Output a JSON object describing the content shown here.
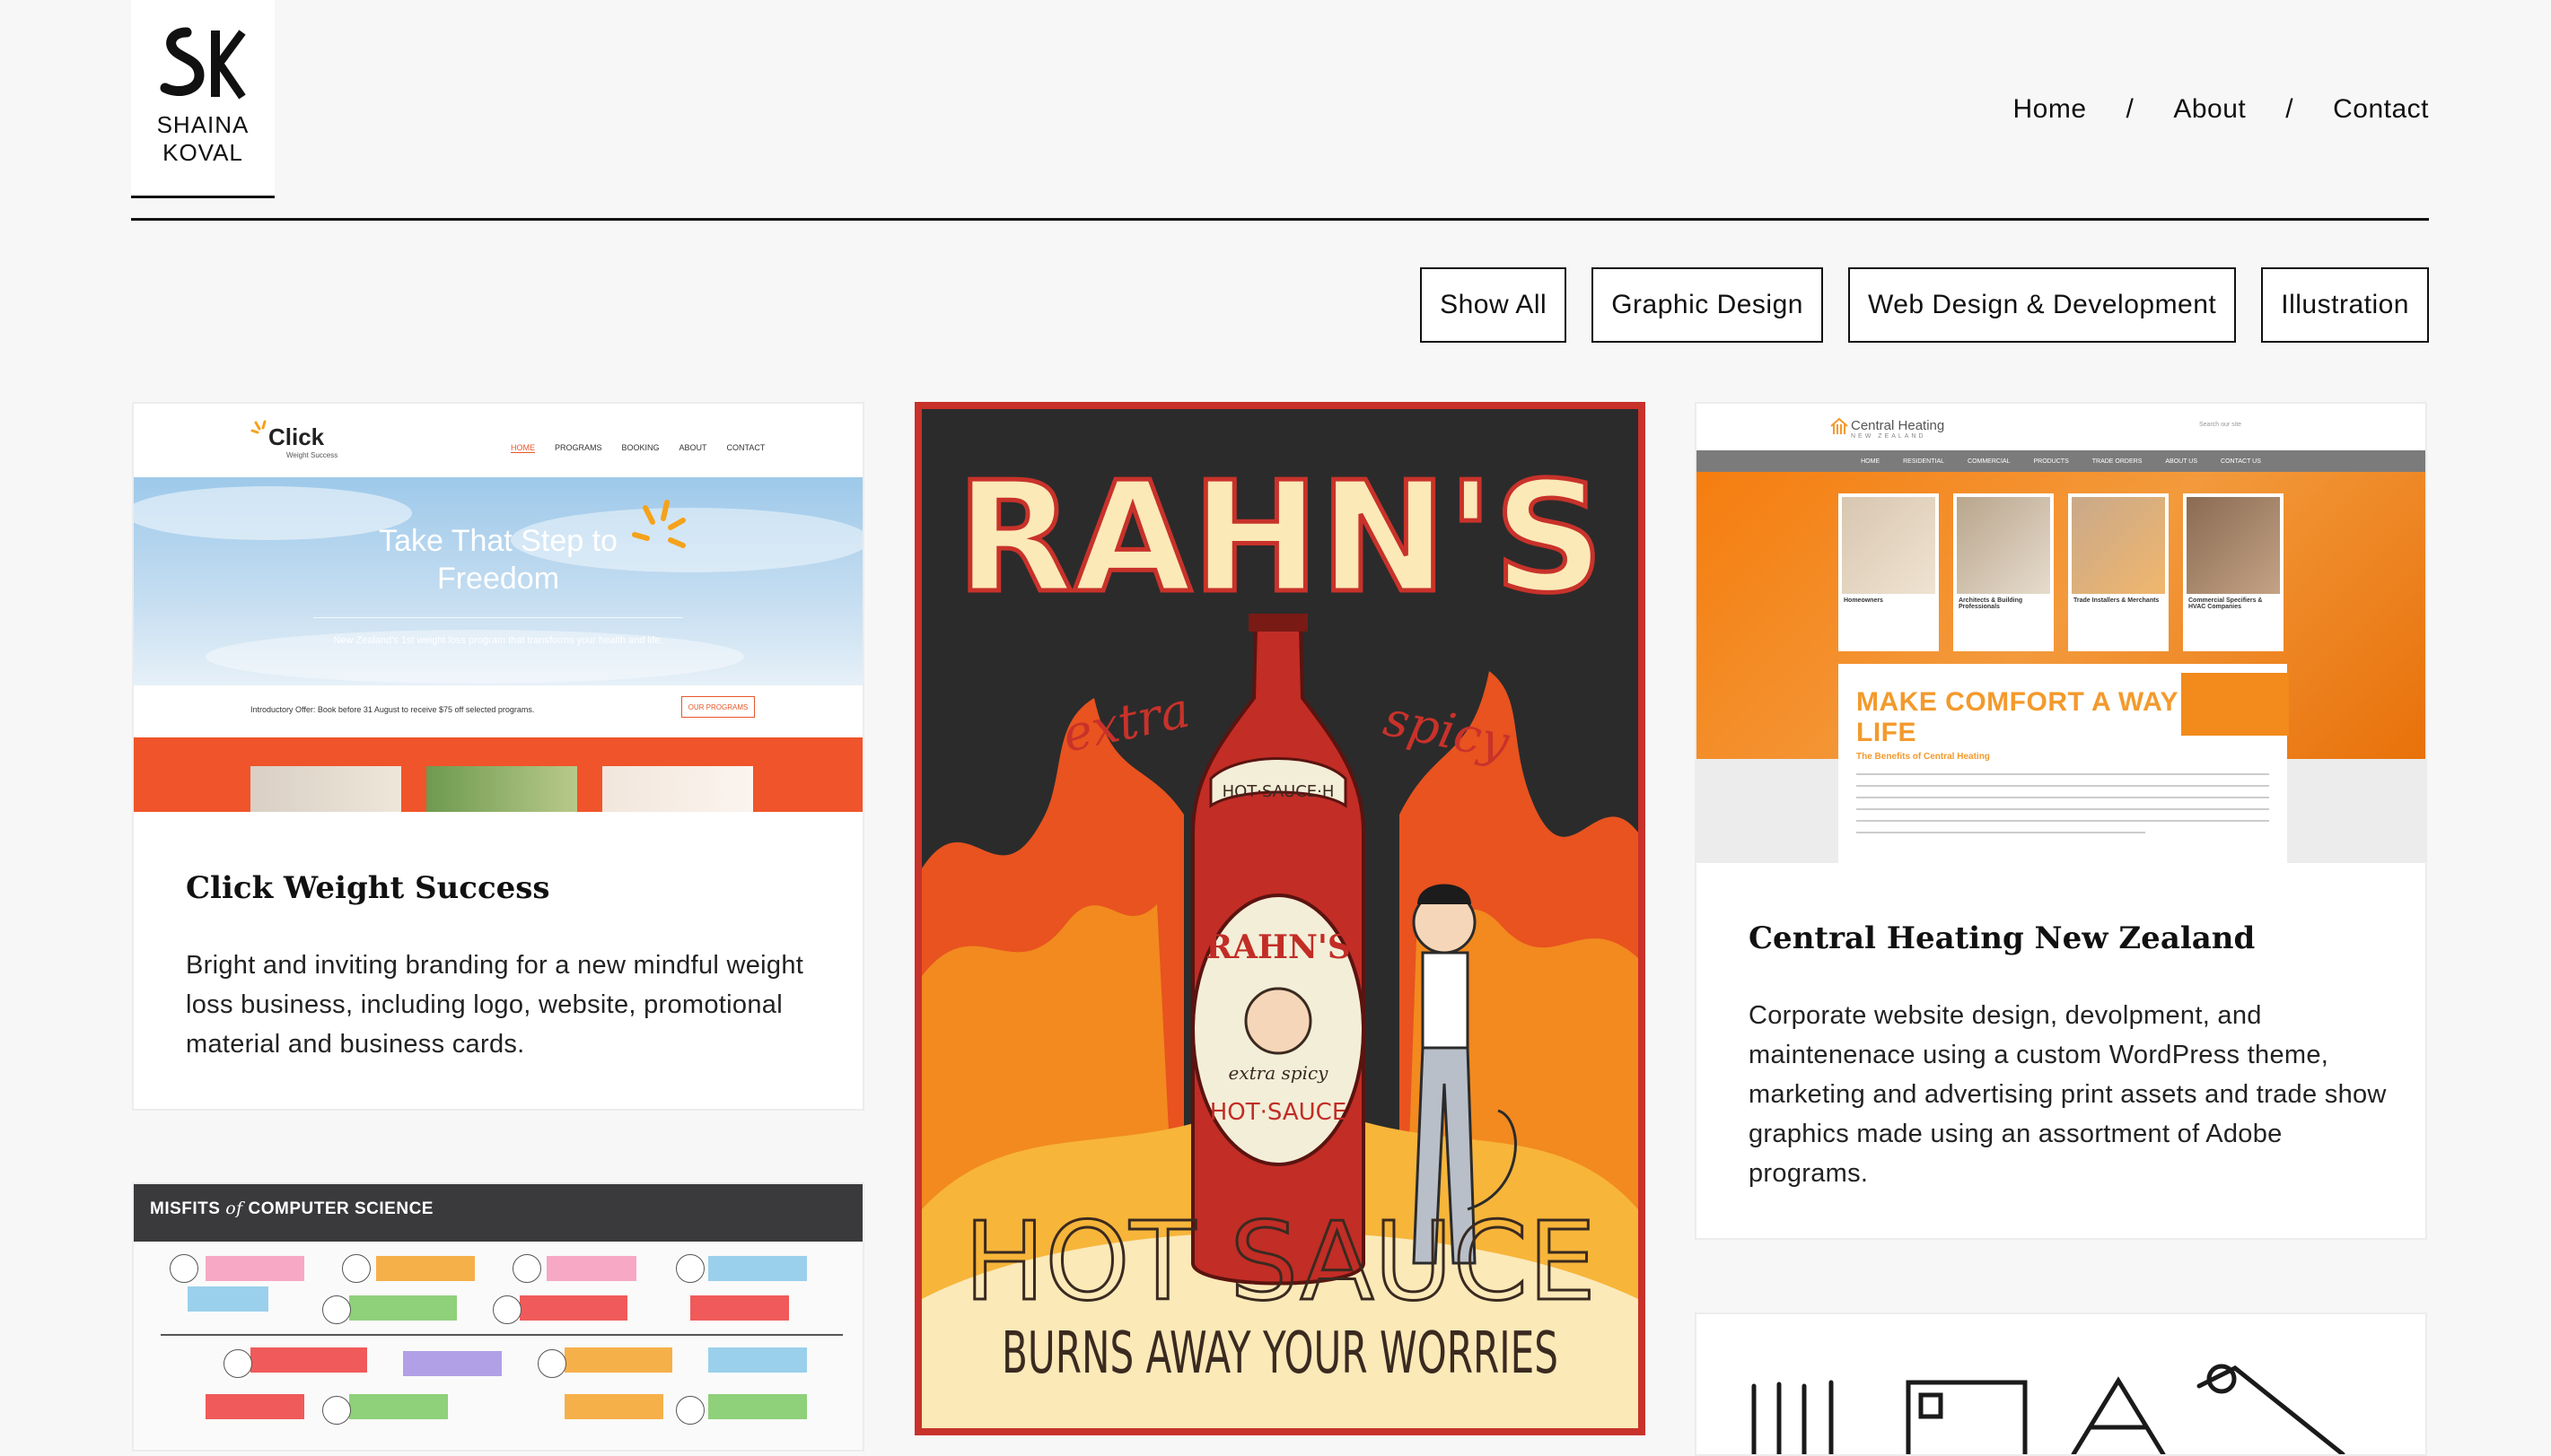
{
  "logo": {
    "line1": "SHAINA",
    "line2": "KOVAL",
    "mark": "SK"
  },
  "nav": {
    "home": "Home",
    "about": "About",
    "contact": "Contact",
    "separator": "/"
  },
  "filters": [
    "Show All",
    "Graphic Design",
    "Web Design & Development",
    "Illustration"
  ],
  "projects": {
    "click": {
      "title": "Click Weight Success",
      "description": "Bright and inviting branding for a new mindful weight loss business, including logo, website, promotional material and business cards.",
      "screenshot": {
        "logo": "Click",
        "logo_sub": "Weight Success",
        "nav": [
          "HOME",
          "PROGRAMS",
          "BOOKING",
          "ABOUT",
          "CONTACT"
        ],
        "hero_line1": "Take That Step to",
        "hero_line2": "Freedom",
        "hero_sub": "New Zealand's 1st weight loss program that transforms your health and life.",
        "offer": "Introductory Offer: Book before 31 August to receive $75 off selected programs.",
        "offer_button": "OUR PROGRAMS"
      }
    },
    "poster": {
      "brand": "RAHN'S",
      "tagline_left": "extra",
      "tagline_right": "spicy",
      "product": "HOT SAUCE",
      "slogan": "BURNS AWAY YOUR WORRIES",
      "bottle_label": "RAHN'S",
      "bottle_sub": "extra spicy",
      "bottle_product": "HOT·SAUCE",
      "neck": "HOT·SAUCE·H"
    },
    "central": {
      "title": "Central Heating New Zealand",
      "description": "Corporate website design, devolpment, and maintenenace using a custom WordPress theme, marketing and advertising print assets and trade show graphics made using an assortment of Adobe programs.",
      "screenshot": {
        "logo": "Central Heating",
        "logo_sub": "NEW ZEALAND",
        "search": "Search our site",
        "nav": [
          "HOME",
          "RESIDENTIAL",
          "COMMERCIAL",
          "PRODUCTS",
          "TRADE ORDERS",
          "ABOUT US",
          "CONTACT US"
        ],
        "tiles": [
          "Homeowners",
          "Architects & Building Professionals",
          "Trade Installers & Merchants",
          "Commercial Specifiers & HVAC Companies"
        ],
        "headline": "MAKE COMFORT A WAY OF LIFE",
        "subhead": "The Benefits of Central Heating"
      }
    },
    "misfits": {
      "title_pre": "MISFITS",
      "title_of": "of",
      "title_post": "COMPUTER SCIENCE"
    }
  },
  "colors": {
    "page_bg": "#f7f7f7",
    "click_orange": "#f0542a",
    "central_orange": "#f57d0f",
    "poster_black": "#2a2a2a",
    "poster_red": "#c8322a",
    "poster_cream": "#fbe9b8"
  }
}
